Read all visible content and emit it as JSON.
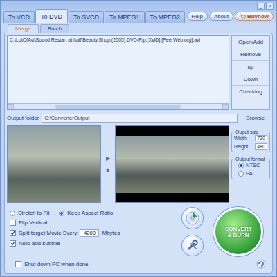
{
  "window": {
    "controls": [
      "_",
      "×"
    ]
  },
  "tabs": [
    {
      "label": "To VCD",
      "selected": false
    },
    {
      "label": "To DVD",
      "selected": true
    },
    {
      "label": "To SVCD",
      "selected": false
    },
    {
      "label": "To MPEG1",
      "selected": false
    },
    {
      "label": "To MPEG2",
      "selected": false
    }
  ],
  "header_buttons": [
    {
      "label": "Help",
      "kind": "plain"
    },
    {
      "label": "About",
      "kind": "plain"
    },
    {
      "label": "Buynow",
      "kind": "buy"
    }
  ],
  "subtabs": [
    {
      "label": "Merge",
      "selected": true
    },
    {
      "label": "Batch",
      "selected": false
    }
  ],
  "file_list": {
    "items": [
      {
        "path": "C:\\LotOfAvi\\Sound Restart at half\\Beauty.Shop.(2005).DVD-Rip.[XviD].[PeerWeb.org].avi",
        "selected": false
      }
    ]
  },
  "list_buttons": [
    "Open/Add",
    "Remove",
    "up",
    "Down",
    "Checklog"
  ],
  "output_folder": {
    "label": "Output folder",
    "value": "C:\\ConverterOutput",
    "button": "Browse"
  },
  "player_controls": [
    "▶",
    "■"
  ],
  "output_size": {
    "title": "Ouput size",
    "fields": [
      {
        "label": "Width",
        "value": "720"
      },
      {
        "label": "Height",
        "value": "480"
      }
    ]
  },
  "output_format": {
    "title": "Output format",
    "options": [
      {
        "label": "NTSC",
        "selected": true
      },
      {
        "label": "PAL",
        "selected": false
      }
    ]
  },
  "scaling": [
    {
      "label": "Stretch to Fit",
      "selected": false
    },
    {
      "label": "Keep Aspect Ratio",
      "selected": true
    }
  ],
  "options": [
    {
      "kind": "checkbox",
      "label": "Flip Vertical",
      "checked": false
    },
    {
      "kind": "split",
      "label": "Split target Movie Every",
      "checked": true,
      "value": "4200",
      "unit": "Mbytes"
    },
    {
      "kind": "checkbox",
      "label": "Auto add subtitle",
      "checked": true
    }
  ],
  "shutdown": {
    "label": "Shut down PC when done",
    "checked": false
  },
  "convert_button": {
    "lines": [
      "CONVERT",
      "& BURN"
    ]
  }
}
